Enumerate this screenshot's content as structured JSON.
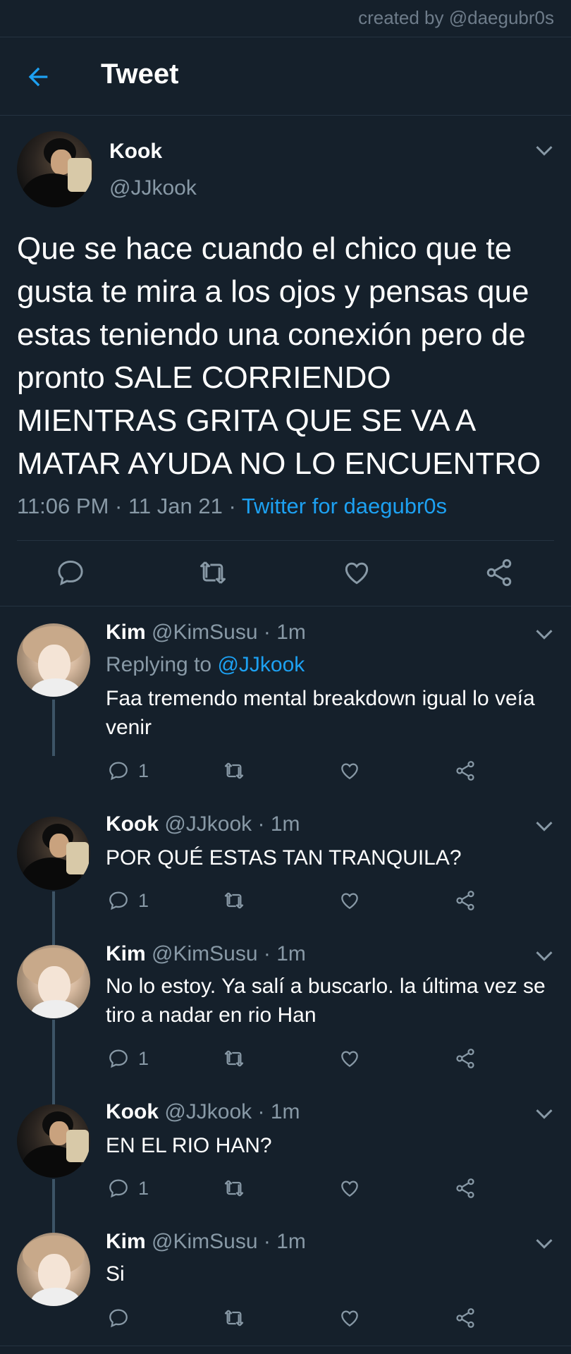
{
  "watermark": "created by @daegubr0s",
  "header": {
    "title": "Tweet"
  },
  "main_tweet": {
    "name": "Kook",
    "handle": "@JJkook",
    "text": "Que se hace cuando el chico que te gusta te mira a los ojos y pensas que estas teniendo una conexión pero de pronto SALE CORRIENDO MIENTRAS GRITA QUE SE VA A MATAR AYUDA NO LO ENCUENTRO",
    "time": "11:06 PM",
    "sep1": " · ",
    "date": "11 Jan 21",
    "sep2": " · ",
    "source": "Twitter for daegubr0s"
  },
  "replies": [
    {
      "name": "Kim",
      "handle": "@KimSusu",
      "sep": " · ",
      "time": "1m",
      "replying_prefix": "Replying to ",
      "replying_to": "@JJkook",
      "text": "Faa tremendo mental breakdown igual lo veía venir",
      "reply_count": "1"
    },
    {
      "name": "Kook",
      "handle": "@JJkook",
      "sep": " · ",
      "time": "1m",
      "text": "POR QUÉ ESTAS TAN TRANQUILA?",
      "reply_count": "1"
    },
    {
      "name": "Kim",
      "handle": "@KimSusu",
      "sep": " · ",
      "time": "1m",
      "text": "No lo estoy. Ya salí a buscarlo. la última vez se tiro a nadar en rio Han",
      "reply_count": "1"
    },
    {
      "name": "Kook",
      "handle": "@JJkook",
      "sep": " · ",
      "time": "1m",
      "text": "EN EL RIO HAN?",
      "reply_count": "1"
    },
    {
      "name": "Kim",
      "handle": "@KimSusu",
      "sep": " · ",
      "time": "1m",
      "text": "Si",
      "reply_count": ""
    }
  ],
  "icons": {
    "back": "arrow-left-icon",
    "more": "chevron-down-icon",
    "reply": "comment-icon",
    "retweet": "retweet-icon",
    "like": "heart-icon",
    "share": "share-icon"
  },
  "colors": {
    "background": "#15202b",
    "accent": "#1da1f2",
    "secondary_text": "#8899a6",
    "divider": "#253341"
  }
}
